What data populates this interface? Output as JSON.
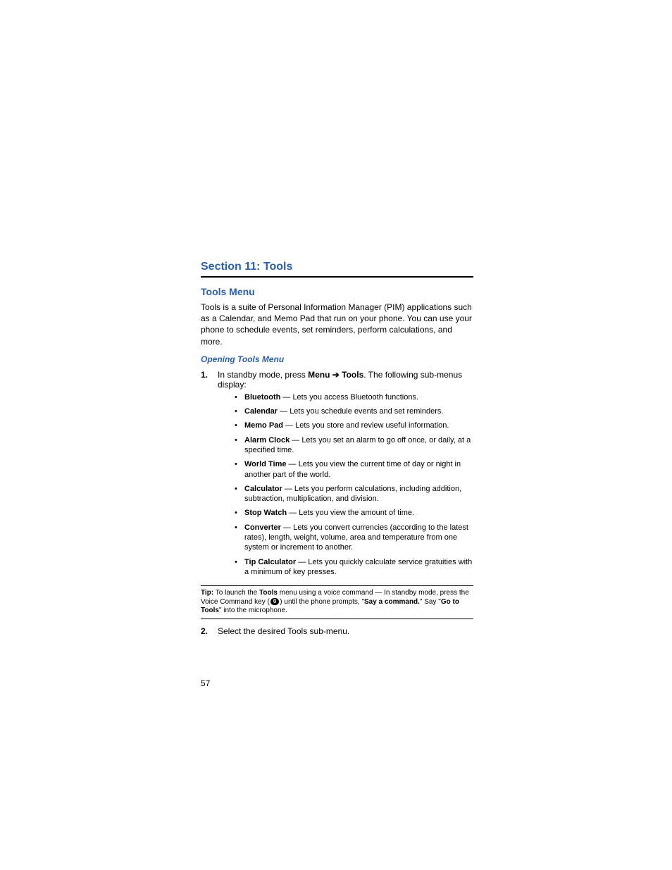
{
  "section_title": "Section 11: Tools",
  "subhead": "Tools Menu",
  "intro": "Tools is a suite of Personal Information Manager (PIM) applications such as a Calendar, and Memo Pad that run on your phone. You can use your phone to schedule events, set reminders, perform calculations, and more.",
  "subsubhead": "Opening Tools Menu",
  "step1": {
    "num": "1.",
    "lead": "In standby mode, press ",
    "menu_bold": "Menu",
    "arrow": " ➔ ",
    "tools_bold": "Tools",
    "tail": ". The following sub-menus display:"
  },
  "bullets": [
    {
      "term": "Bluetooth",
      "desc": " — Lets you access Bluetooth functions."
    },
    {
      "term": "Calendar",
      "desc": " — Lets you schedule events and set reminders."
    },
    {
      "term": "Memo Pad",
      "desc": " — Lets you store and review useful information."
    },
    {
      "term": "Alarm Clock",
      "desc": " — Lets you set an alarm to go off once, or daily, at a specified time."
    },
    {
      "term": "World Time",
      "desc": " — Lets you view the current time of day or night in another part of the world."
    },
    {
      "term": "Calculator",
      "desc": " — Lets you perform calculations, including addition, subtraction, multiplication, and division."
    },
    {
      "term": "Stop Watch",
      "desc": " — Lets you view the amount of time."
    },
    {
      "term": "Converter",
      "desc": " — Lets you convert currencies (according to the latest rates), length, weight, volume, area and temperature from one system or increment to another."
    },
    {
      "term": "Tip Calculator",
      "desc": " — Lets you quickly calculate service gratuities with a minimum of key presses."
    }
  ],
  "tip": {
    "label": "Tip:",
    "p1": " To launch the ",
    "b1": "Tools",
    "p2": " menu using a voice command — In standby mode, press the Voice Command key (",
    "icon_text": "0",
    "p3": ") until the phone prompts, \"",
    "b2": "Say a command.",
    "p4": "\" Say \"",
    "b3": "Go to Tools",
    "p5": "\" into the microphone."
  },
  "step2": {
    "num": "2.",
    "text": "Select the desired Tools sub-menu."
  },
  "page_number": "57"
}
